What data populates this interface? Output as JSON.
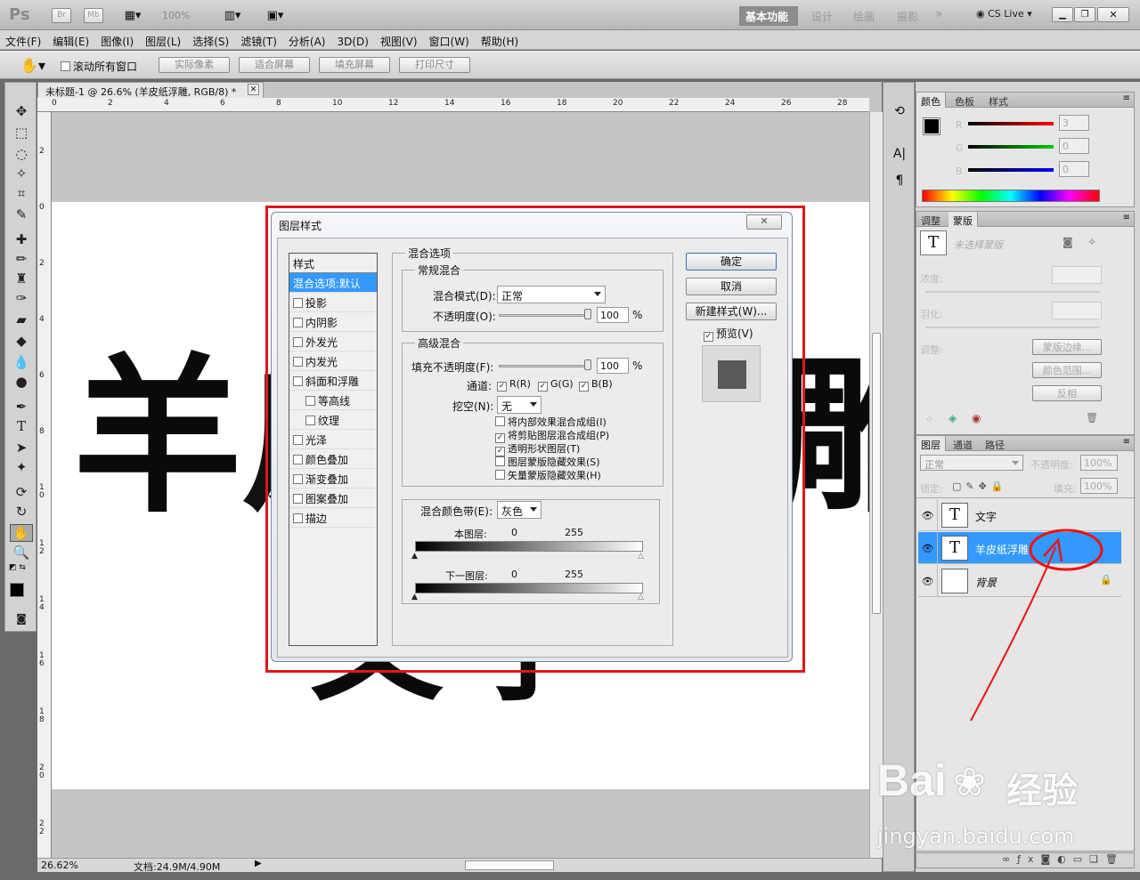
{
  "app": {
    "logo": "Ps",
    "badges": [
      "Br",
      "Mb"
    ],
    "zoom_select": "100%",
    "workspaces": [
      "基本功能",
      "设计",
      "绘画",
      "摄影"
    ],
    "more": "»",
    "cslive": "CS Live"
  },
  "menu": [
    "文件(F)",
    "编辑(E)",
    "图像(I)",
    "图层(L)",
    "选择(S)",
    "滤镜(T)",
    "分析(A)",
    "3D(D)",
    "视图(V)",
    "窗口(W)",
    "帮助(H)"
  ],
  "options": {
    "scroll_all": "滚动所有窗口",
    "buttons": [
      "实际像素",
      "适合屏幕",
      "填充屏幕",
      "打印尺寸"
    ]
  },
  "document": {
    "tab_title": "未标题-1 @ 26.6% (羊皮纸浮雕, RGB/8) *",
    "ruler_h": [
      "0",
      "2",
      "4",
      "6",
      "8",
      "10",
      "12",
      "14",
      "16",
      "18",
      "20",
      "22",
      "24",
      "26",
      "28"
    ],
    "ruler_v": [
      "2",
      "0",
      "2",
      "4",
      "6",
      "8",
      "1\n0",
      "1\n2",
      "1\n4",
      "1\n6",
      "1\n8",
      "2\n0",
      "2\n2"
    ],
    "canvas_text": [
      "羊",
      "皮",
      "雕",
      "文",
      "字"
    ],
    "status_zoom": "26.62%",
    "status_doc": "文档:24.9M/4.90M"
  },
  "dialog": {
    "title": "图层样式",
    "close": "✕",
    "styles_header": "样式",
    "styles": [
      {
        "label": "混合选项:默认",
        "checkbox": false,
        "selected": true
      },
      {
        "label": "投影",
        "checkbox": true
      },
      {
        "label": "内阴影",
        "checkbox": true
      },
      {
        "label": "外发光",
        "checkbox": true
      },
      {
        "label": "内发光",
        "checkbox": true
      },
      {
        "label": "斜面和浮雕",
        "checkbox": true
      },
      {
        "label": "等高线",
        "checkbox": true,
        "indent": true
      },
      {
        "label": "纹理",
        "checkbox": true,
        "indent": true
      },
      {
        "label": "光泽",
        "checkbox": true
      },
      {
        "label": "颜色叠加",
        "checkbox": true
      },
      {
        "label": "渐变叠加",
        "checkbox": true
      },
      {
        "label": "图案叠加",
        "checkbox": true
      },
      {
        "label": "描边",
        "checkbox": true
      }
    ],
    "blend_options": "混合选项",
    "general_blend": "常规混合",
    "blend_mode_label": "混合模式(D):",
    "blend_mode": "正常",
    "opacity_label": "不透明度(O):",
    "opacity": "100",
    "percent": "%",
    "advanced_blend": "高级混合",
    "fill_opacity_label": "填充不透明度(F):",
    "fill_opacity": "100",
    "channels_label": "通道:",
    "channels": [
      "R(R)",
      "G(G)",
      "B(B)"
    ],
    "knockout_label": "挖空(N):",
    "knockout": "无",
    "adv_checks": [
      {
        "label": "将内部效果混合成组(I)",
        "checked": false
      },
      {
        "label": "将剪贴图层混合成组(P)",
        "checked": true
      },
      {
        "label": "透明形状图层(T)",
        "checked": true
      },
      {
        "label": "图层蒙版隐藏效果(S)",
        "checked": false
      },
      {
        "label": "矢量蒙版隐藏效果(H)",
        "checked": false
      }
    ],
    "blend_if_label": "混合颜色带(E):",
    "blend_if": "灰色",
    "this_layer": "本图层:",
    "under_layer": "下一图层:",
    "val_0": "0",
    "val_255": "255",
    "ok": "确定",
    "cancel": "取消",
    "new_style": "新建样式(W)...",
    "preview": "预览(V)"
  },
  "color_panel": {
    "tabs": [
      "颜色",
      "色板",
      "样式"
    ],
    "r_label": "R",
    "g_label": "G",
    "b_label": "B",
    "r": "3",
    "g": "0",
    "b": "0"
  },
  "mask_panel": {
    "tabs": [
      "调整",
      "蒙版"
    ],
    "no_mask": "未选择蒙版",
    "density": "浓度:",
    "feather": "羽化:",
    "refine": "调整:",
    "edge": "蒙版边缘...",
    "color_range": "颜色范围...",
    "invert": "反相"
  },
  "layers_panel": {
    "tabs": [
      "图层",
      "通道",
      "路径"
    ],
    "blend": "正常",
    "opacity_label": "不透明度:",
    "opacity": "100%",
    "lock_label": "锁定:",
    "fill_label": "填充:",
    "fill": "100%",
    "layers": [
      {
        "name": "文字",
        "type": "text",
        "selected": false
      },
      {
        "name": "羊皮纸浮雕",
        "type": "text",
        "selected": true
      },
      {
        "name": "背景",
        "type": "background",
        "selected": false
      }
    ]
  },
  "watermark": {
    "brand": "Bai",
    "brand2": "经验",
    "url": "jingyan.baidu.com"
  }
}
